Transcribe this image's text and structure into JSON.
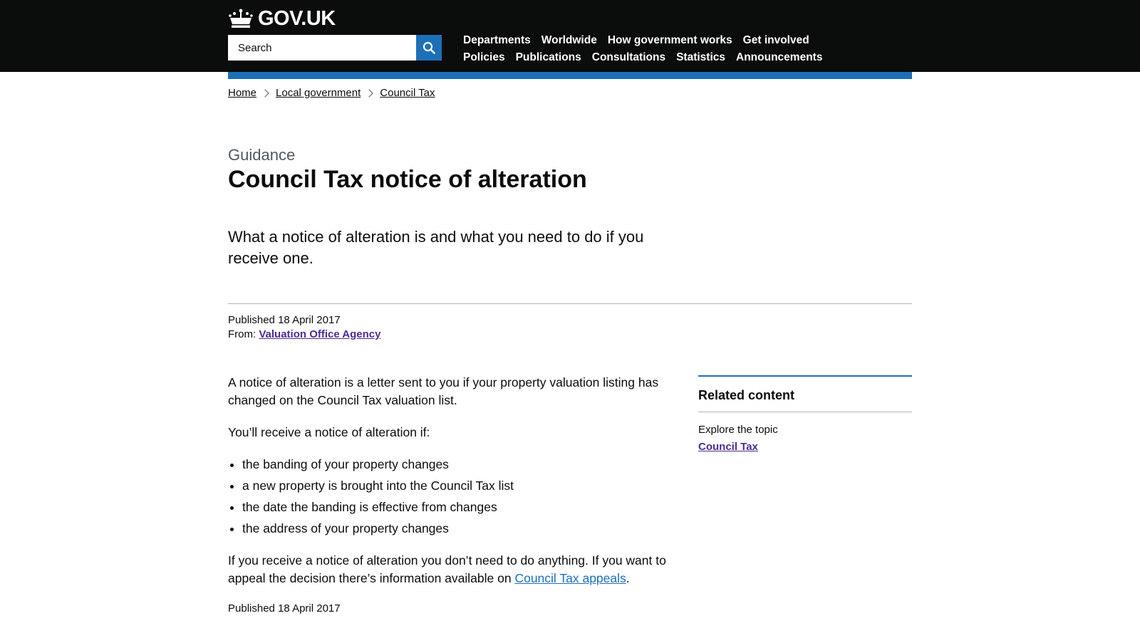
{
  "header": {
    "logo_text": "GOV.UK",
    "search_placeholder": "Search",
    "nav_row1": [
      "Departments",
      "Worldwide",
      "How government works",
      "Get involved"
    ],
    "nav_row2": [
      "Policies",
      "Publications",
      "Consultations",
      "Statistics",
      "Announcements"
    ]
  },
  "breadcrumbs": [
    "Home",
    "Local government",
    "Council Tax"
  ],
  "page": {
    "caption": "Guidance",
    "title": "Council Tax notice of alteration",
    "lead": "What a notice of alteration is and what you need to do if you receive one."
  },
  "metadata": {
    "published_label": "Published",
    "published_date": "18 April 2017",
    "from_label": "From:",
    "from_org": "Valuation Office Agency"
  },
  "body": {
    "para1": "A notice of alteration is a letter sent to you if your property valuation listing has changed on the Council Tax valuation list.",
    "para2": "You’ll receive a notice of alteration if:",
    "list": [
      "the banding of your property changes",
      "a new property is brought into the Council Tax list",
      "the date the banding is effective from changes",
      "the address of your property changes"
    ],
    "para3_text": "If you receive a notice of alteration you don’t need to do anything. If you want to appeal the decision there’s information available on ",
    "para3_link": "Council Tax appeals",
    "para3_end": ".",
    "footer_published": "Published 18 April 2017"
  },
  "related": {
    "heading": "Related content",
    "subheading": "Explore the topic",
    "link": "Council Tax"
  },
  "colors": {
    "header_bg": "#0b0c0c",
    "brand_blue": "#1d70b8",
    "visited_link": "#4c2c92",
    "secondary_text": "#505a5f"
  },
  "icons": {
    "logo": "crown-icon",
    "search": "search-icon",
    "breadcrumb_separator": "chevron-right-icon"
  }
}
